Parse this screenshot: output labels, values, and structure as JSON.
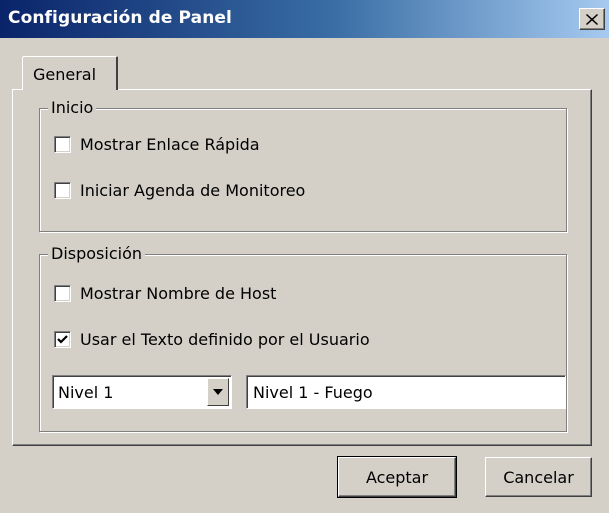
{
  "window": {
    "title": "Configuración de Panel",
    "close_icon": "close-icon"
  },
  "tabs": [
    {
      "label": "General",
      "active": true
    }
  ],
  "inicio": {
    "legend": "Inicio",
    "options": [
      {
        "label": "Mostrar Enlace Rápida",
        "checked": false
      },
      {
        "label": "Iniciar Agenda de Monitoreo",
        "checked": false
      }
    ]
  },
  "disposicion": {
    "legend": "Disposición",
    "options": [
      {
        "label": "Mostrar Nombre de Host",
        "checked": false
      },
      {
        "label": "Usar el Texto definido por el Usuario",
        "checked": true
      }
    ],
    "level_select": {
      "value": "Nivel 1"
    },
    "text_input": {
      "value": "Nivel 1 - Fuego"
    }
  },
  "buttons": {
    "accept": "Aceptar",
    "cancel": "Cancelar"
  },
  "colors": {
    "titlebar_start": "#0a246a",
    "titlebar_end": "#a6caf0",
    "face": "#d4d0c8"
  }
}
